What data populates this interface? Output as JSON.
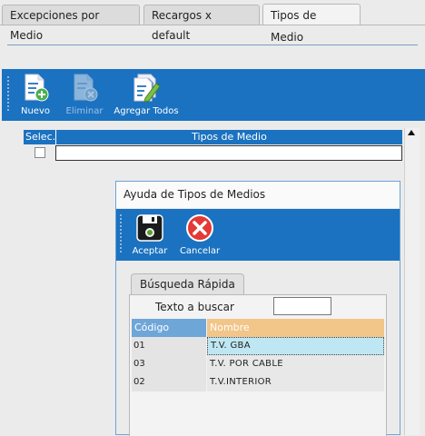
{
  "tabs": [
    {
      "label": "Excepciones por Medio",
      "active": false
    },
    {
      "label": "Recargos x default",
      "active": false
    },
    {
      "label": "Tipos de Medio",
      "active": true
    }
  ],
  "toolbar": {
    "nuevo": {
      "label": "Nuevo",
      "icon": "new-document-plus-icon"
    },
    "eliminar": {
      "label": "Eliminar",
      "icon": "delete-document-icon",
      "disabled": true
    },
    "agregar_todos": {
      "label": "Agregar Todos",
      "icon": "add-all-documents-icon"
    }
  },
  "grid": {
    "columns": {
      "select": "Selec.",
      "name": "Tipos de Medio"
    }
  },
  "dialog": {
    "title": "Ayuda de Tipos de Medios",
    "toolbar": {
      "accept": {
        "label": "Aceptar",
        "icon": "save-disk-icon"
      },
      "cancel": {
        "label": "Cancelar",
        "icon": "cancel-x-icon"
      }
    },
    "tab": {
      "label": "Búsqueda Rápida"
    },
    "search": {
      "label": "Texto a buscar",
      "value": ""
    },
    "results": {
      "columns": {
        "code": "Código",
        "name": "Nombre"
      },
      "rows": [
        {
          "code": "01",
          "name": "T.V. GBA",
          "selected": true
        },
        {
          "code": "03",
          "name": "T.V. POR CABLE",
          "selected": false
        },
        {
          "code": "02",
          "name": "T.V.INTERIOR",
          "selected": false
        }
      ]
    }
  },
  "colors": {
    "toolbar_blue": "#1b72c0",
    "code_header": "#6fa6d8",
    "name_header": "#f2c589",
    "selected_row": "#bfe7f3"
  }
}
